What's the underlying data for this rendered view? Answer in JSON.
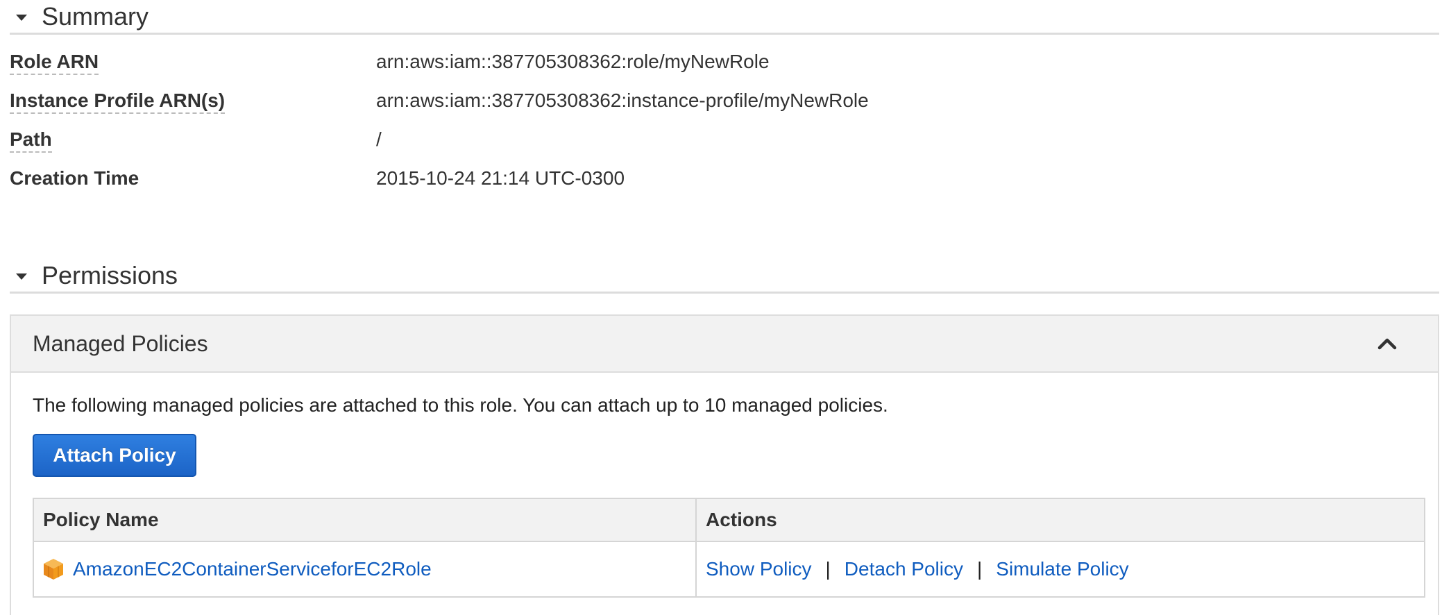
{
  "summary": {
    "title": "Summary",
    "rows": [
      {
        "label": "Role ARN",
        "value": "arn:aws:iam::387705308362:role/myNewRole"
      },
      {
        "label": "Instance Profile ARN(s)",
        "value": "arn:aws:iam::387705308362:instance-profile/myNewRole"
      },
      {
        "label": "Path",
        "value": "/"
      },
      {
        "label": "Creation Time",
        "value": "2015-10-24 21:14 UTC-0300"
      }
    ]
  },
  "permissions": {
    "title": "Permissions",
    "managed_policies": {
      "title": "Managed Policies",
      "description": "The following managed policies are attached to this role. You can attach up to 10 managed policies.",
      "attach_button": "Attach Policy",
      "table": {
        "headers": [
          "Policy Name",
          "Actions"
        ],
        "rows": [
          {
            "policy_name": "AmazonEC2ContainerServiceforEC2Role",
            "actions": [
              "Show Policy",
              "Detach Policy",
              "Simulate Policy"
            ]
          }
        ]
      }
    }
  },
  "colors": {
    "link": "#0f5cbf",
    "button_blue": "#1c64c7",
    "panel_header_bg": "#f2f2f2",
    "policy_icon_orange": "#f29b1d"
  },
  "icons": {
    "section_toggle": "caret-down-icon",
    "panel_collapse": "chevron-up-icon",
    "policy": "aws-policy-cube-icon"
  }
}
